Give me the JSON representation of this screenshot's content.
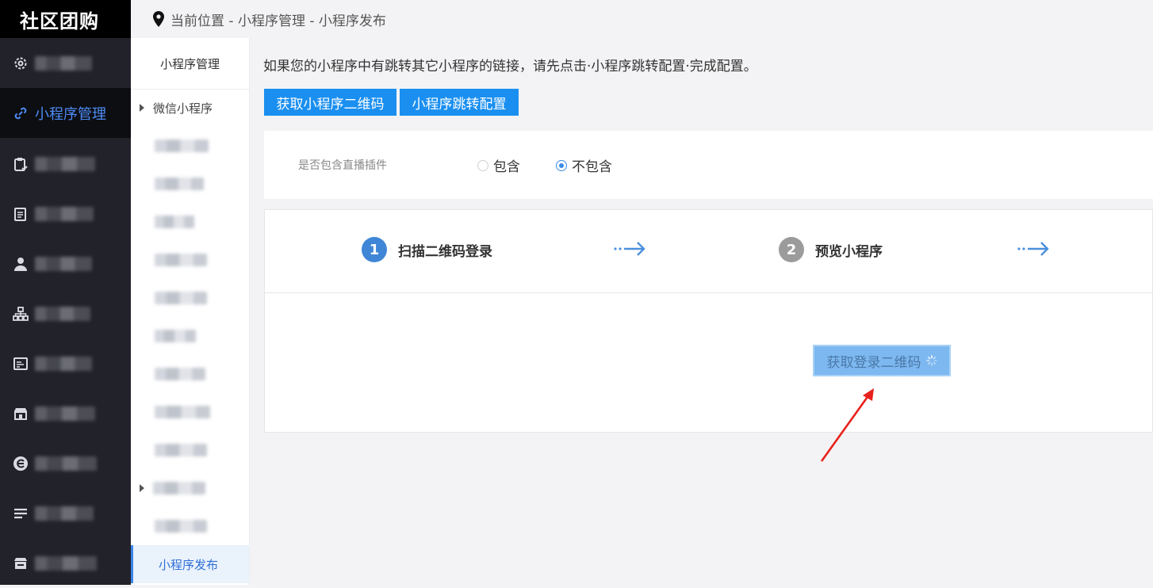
{
  "brand": "社区团购",
  "breadcrumb": "当前位置 - 小程序管理 - 小程序发布",
  "sidebar": {
    "items": [
      {
        "icon": "gear-icon",
        "label": "系统管理",
        "active": false,
        "obscured": true
      },
      {
        "icon": "link-icon",
        "label": "小程序管理",
        "active": true,
        "obscured": false
      },
      {
        "icon": "clipboard-icon",
        "label": "",
        "active": false,
        "obscured": true
      },
      {
        "icon": "document-icon",
        "label": "",
        "active": false,
        "obscured": true
      },
      {
        "icon": "user-icon",
        "label": "用户管理",
        "active": false,
        "obscured": true
      },
      {
        "icon": "hierarchy-icon",
        "label": "分销中心",
        "active": false,
        "obscured": true
      },
      {
        "icon": "content-icon",
        "label": "内容管理",
        "active": false,
        "obscured": true
      },
      {
        "icon": "store-icon",
        "label": "",
        "active": false,
        "obscured": true
      },
      {
        "icon": "e-logo-icon",
        "label": "",
        "active": false,
        "obscured": true
      },
      {
        "icon": "list-icon",
        "label": "",
        "active": false,
        "obscured": true
      },
      {
        "icon": "shop-icon",
        "label": "",
        "active": false,
        "obscured": true
      }
    ]
  },
  "submenu": {
    "title": "小程序管理",
    "group": "微信小程序",
    "active_item": "小程序发布"
  },
  "main": {
    "hint": "如果您的小程序中有跳转其它小程序的链接，请先点击·小程序跳转配置·完成配置。",
    "btn_qrcode": "获取小程序二维码",
    "btn_jump": "小程序跳转配置",
    "plugin_label": "是否包含直播插件",
    "radio_include": "包含",
    "radio_exclude": "不包含",
    "selected": "不包含",
    "steps": [
      {
        "num": "1",
        "label": "扫描二维码登录",
        "color": "#3f86d7"
      },
      {
        "num": "2",
        "label": "预览小程序",
        "color": "#9b9b9b"
      }
    ],
    "login_button": "获取登录二维码"
  },
  "colors": {
    "accent": "#1a8ff0",
    "sidebar_bg": "#22232a",
    "active_text": "#4d8cf5",
    "annotation_arrow": "#e8201c"
  }
}
